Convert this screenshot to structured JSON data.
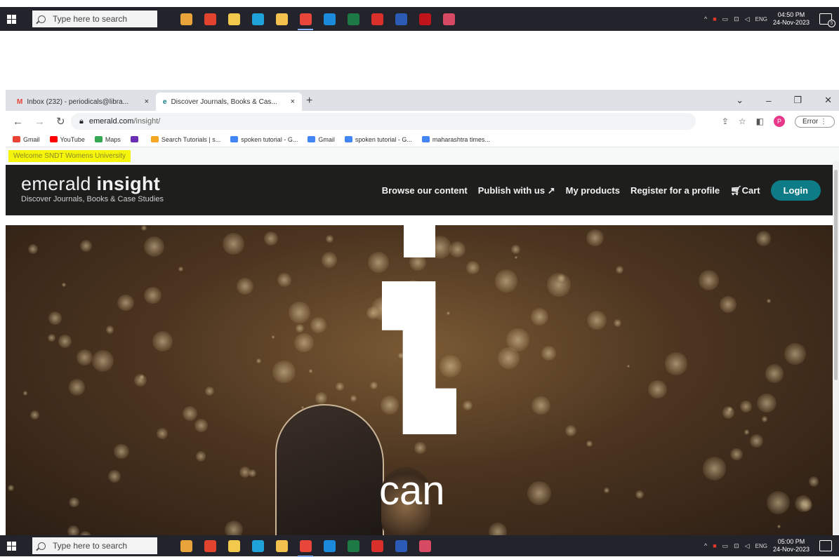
{
  "taskbar_top": {
    "search_placeholder": "Type here to search",
    "time": "04:50 PM",
    "date": "24-Nov-2023",
    "lang": "ENG",
    "notif_count": "5"
  },
  "taskbar_bottom": {
    "search_placeholder": "Type here to search",
    "time": "05:00 PM",
    "date": "24-Nov-2023",
    "lang": "ENG"
  },
  "taskbar_icons": [
    {
      "name": "clock-app-icon",
      "color": "#e8a33a"
    },
    {
      "name": "gift-app-icon",
      "color": "#e2432f"
    },
    {
      "name": "task-view-icon",
      "color": "#f2c94c"
    },
    {
      "name": "edge-icon",
      "color": "#1fa2d8"
    },
    {
      "name": "file-explorer-icon",
      "color": "#f2c14e"
    },
    {
      "name": "chrome-icon",
      "color": "#e9463b"
    },
    {
      "name": "mail-icon",
      "color": "#1c8adb"
    },
    {
      "name": "excel-icon",
      "color": "#1d7a45"
    },
    {
      "name": "red-app-icon",
      "color": "#d9302c"
    },
    {
      "name": "word-icon",
      "color": "#2b5bb5"
    },
    {
      "name": "mcafee-icon",
      "color": "#c0141b"
    },
    {
      "name": "paint-icon",
      "color": "#d64a64"
    }
  ],
  "browser": {
    "tabs": [
      {
        "title": "Inbox (232) - periodicals@libra...",
        "close": "×"
      },
      {
        "title": "Discover Journals, Books & Cas...",
        "close": "×"
      }
    ],
    "new_tab": "+",
    "url_domain": "emerald.com",
    "url_path": "/insight/",
    "profile_initial": "P",
    "error_label": "Error",
    "bookmarks": [
      {
        "label": "Gmail",
        "color": "#ea4335"
      },
      {
        "label": "YouTube",
        "color": "#ff0000"
      },
      {
        "label": "Maps",
        "color": "#34a853"
      },
      {
        "label": "",
        "color": "#6a2fb5"
      },
      {
        "label": "Search Tutorials | s...",
        "color": "#f5a623"
      },
      {
        "label": "spoken tutorial - G...",
        "color": "#4285f4"
      },
      {
        "label": "Gmail",
        "color": "#4285f4"
      },
      {
        "label": "spoken tutorial - G...",
        "color": "#4285f4"
      },
      {
        "label": "maharashtra times...",
        "color": "#4285f4"
      }
    ]
  },
  "page": {
    "welcome": "Welcome SNDT Womens University",
    "logo_light": "emerald ",
    "logo_bold": "insight",
    "tagline": "Discover Journals, Books & Case Studies",
    "nav": [
      "Browse our content",
      "Publish with us",
      "My products",
      "Register for a profile",
      "Cart"
    ],
    "login": "Login",
    "hero_word": "can"
  }
}
